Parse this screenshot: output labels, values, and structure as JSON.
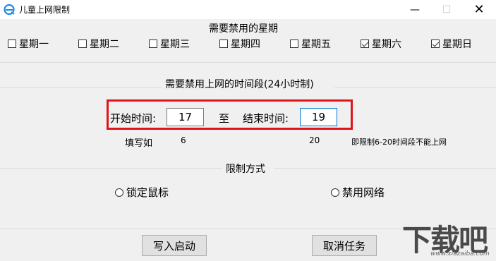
{
  "window": {
    "title": "儿童上网限制",
    "min_symbol": "—",
    "max_symbol": "☐",
    "close_symbol": "✕"
  },
  "days": {
    "title": "需要禁用的星期",
    "items": [
      {
        "label": "星期一",
        "checked": false
      },
      {
        "label": "星期二",
        "checked": false
      },
      {
        "label": "星期三",
        "checked": false
      },
      {
        "label": "星期四",
        "checked": false
      },
      {
        "label": "星期五",
        "checked": false
      },
      {
        "label": "星期六",
        "checked": true
      },
      {
        "label": "星期日",
        "checked": true
      }
    ]
  },
  "time": {
    "title": "需要禁用上网的时间段(24小时制)",
    "start_label": "开始时间:",
    "start_value": "17",
    "to_label": "至",
    "end_label": "结束时间:",
    "end_value": "19",
    "example_label": "填写如",
    "example_start": "6",
    "example_end": "20",
    "example_note": "即限制6-20时间段不能上网"
  },
  "method": {
    "title": "限制方式",
    "option_lock_mouse": "锁定鼠标",
    "option_disable_network": "禁用网络"
  },
  "buttons": {
    "write_start": "写入启动",
    "cancel_task": "取消任务"
  },
  "watermark": {
    "brand": "下载吧",
    "url": "www.xiazaiba.com"
  },
  "colors": {
    "highlight_border": "#e0151c",
    "focus_border": "#0078d7",
    "app_icon": "#1e88e5"
  }
}
